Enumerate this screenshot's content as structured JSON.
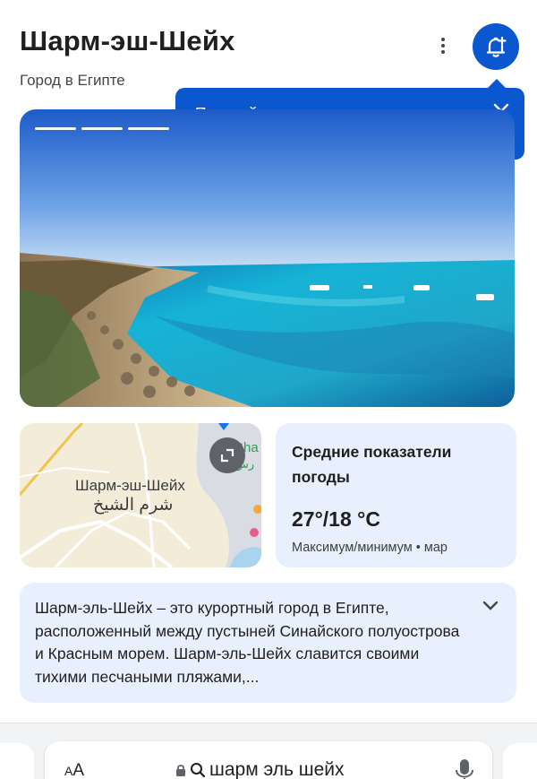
{
  "header": {
    "title": "Шарм-эш-Шейх",
    "subtitle": "Город в Египте"
  },
  "icons": {
    "more": "more-vert-icon",
    "notify": "bell-plus-icon",
    "close": "close-icon",
    "expand": "expand-icon",
    "chevron": "chevron-down-icon",
    "lock": "lock-icon",
    "search": "search-icon",
    "mic": "mic-icon"
  },
  "tooltip": {
    "text": "Получайте уведомления о новостях"
  },
  "hero": {
    "progress_segments": 3,
    "active_segments": 3
  },
  "map": {
    "label_ru": "Шарм-эш-Шейх",
    "label_ar": "شرم الشيخ",
    "edge_label_latin": "Sha",
    "edge_label_ar": "رش"
  },
  "weather": {
    "title": "Средние показатели погоды",
    "temp": "27°/18 °C",
    "sub": "Максимум/минимум • мар"
  },
  "description": {
    "text": "Шарм-эль-Шейх – это курортный город в Египте, расположенный между пустыней Синайского полуострова и Красным морем. Шарм-эль-Шейх славится своими тихими песчаными пляжами,..."
  },
  "browser": {
    "aa_small": "A",
    "aa_large": "A",
    "url": "шарм эль шейх"
  },
  "colors": {
    "accent": "#0b57d0",
    "card_bg": "#e8f0fe",
    "text": "#1f1f1f",
    "subtext": "#444746"
  }
}
